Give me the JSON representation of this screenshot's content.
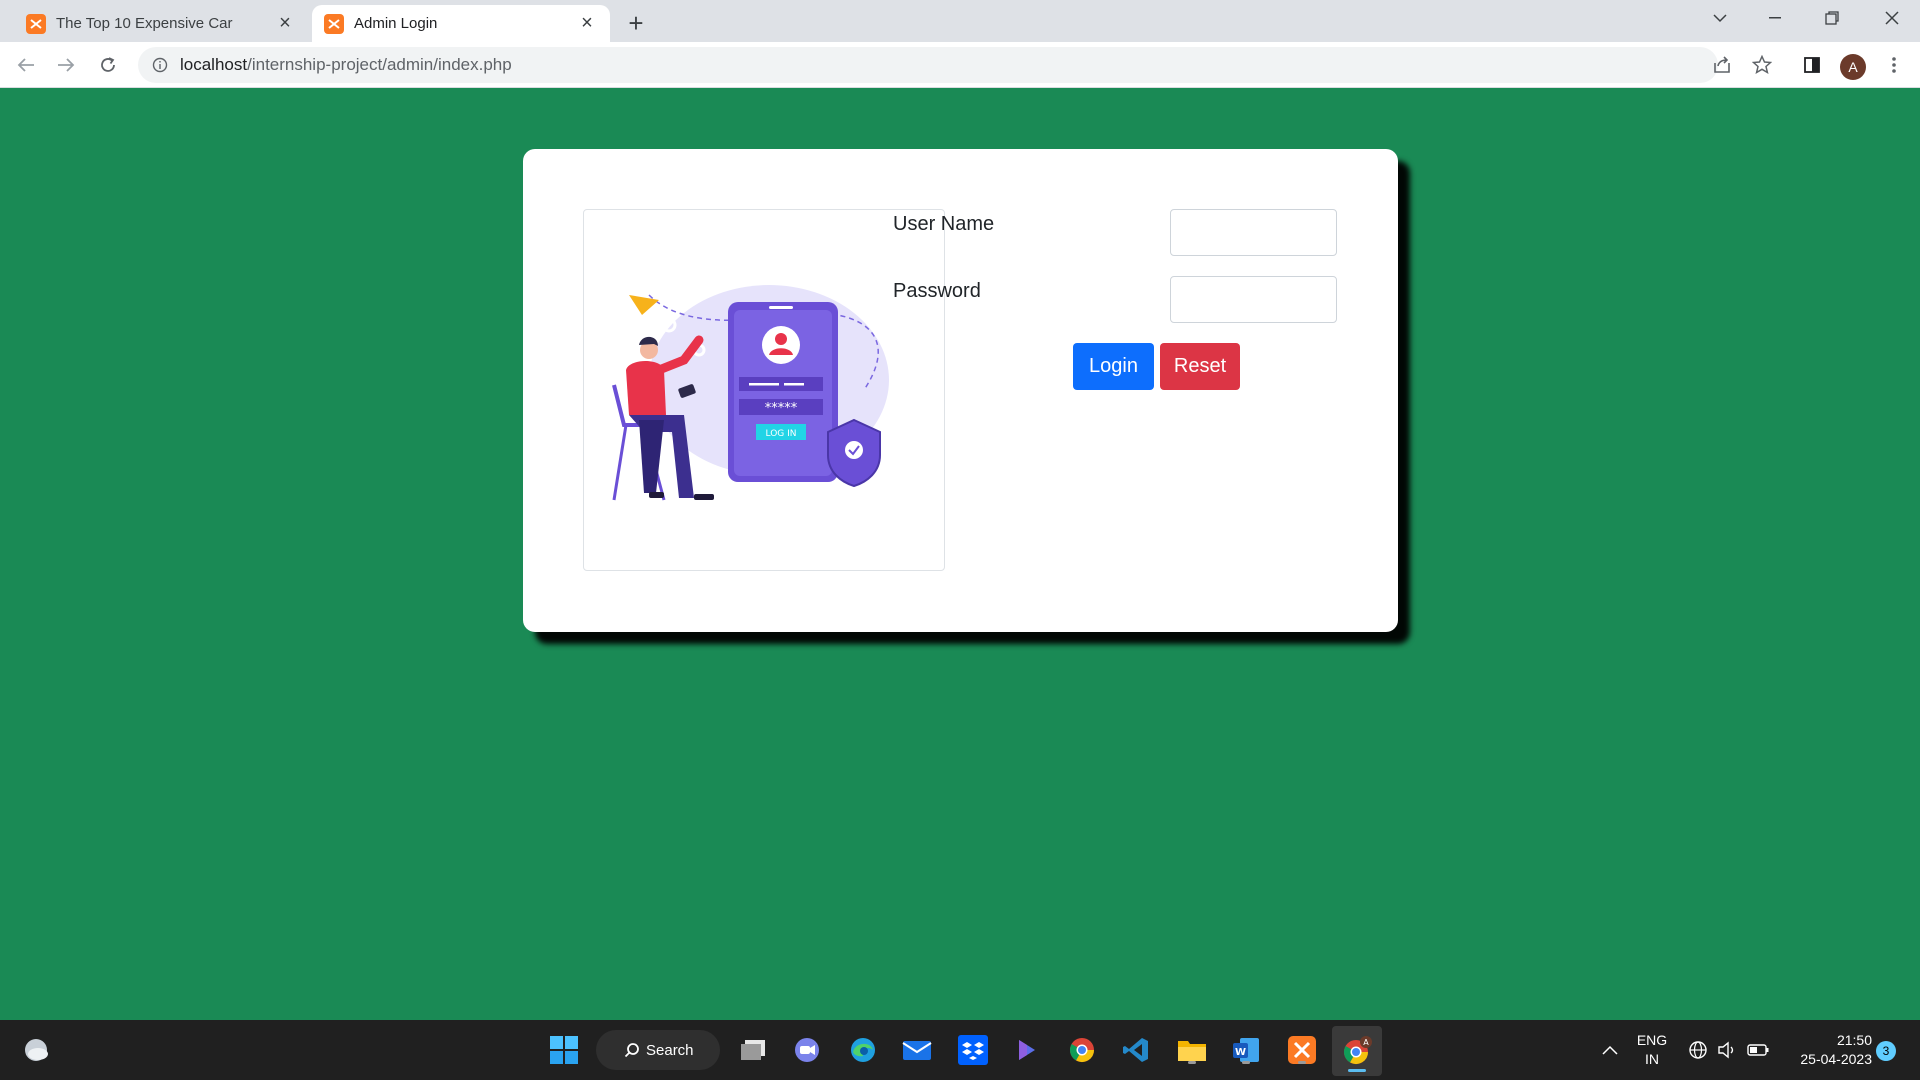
{
  "browser": {
    "tabs": [
      {
        "title": "The Top 10 Expensive Car",
        "active": false
      },
      {
        "title": "Admin Login",
        "active": true
      }
    ],
    "address": {
      "host": "localhost",
      "path": "/internship-project/admin/index.php"
    },
    "profile_initial": "A"
  },
  "page": {
    "background_color": "#1a8a55",
    "form": {
      "username_label": "User Name",
      "username_value": "",
      "password_label": "Password",
      "password_value": "",
      "login_label": "Login",
      "reset_label": "Reset"
    },
    "illustration": {
      "password_mask": "*****",
      "login_text": "LOG IN"
    }
  },
  "taskbar": {
    "search_label": "Search",
    "language": "ENG",
    "region": "IN",
    "time": "21:50",
    "date": "25-04-2023",
    "notification_count": "3",
    "pinned": [
      "weather",
      "start",
      "search",
      "task-view",
      "teams",
      "edge",
      "mail",
      "dropbox",
      "copilot",
      "chrome",
      "vscode",
      "file-explorer",
      "word",
      "xampp",
      "chrome-profile"
    ]
  },
  "colors": {
    "primary": "#0d6efd",
    "danger": "#dc3545",
    "page_green": "#1a8a55"
  }
}
